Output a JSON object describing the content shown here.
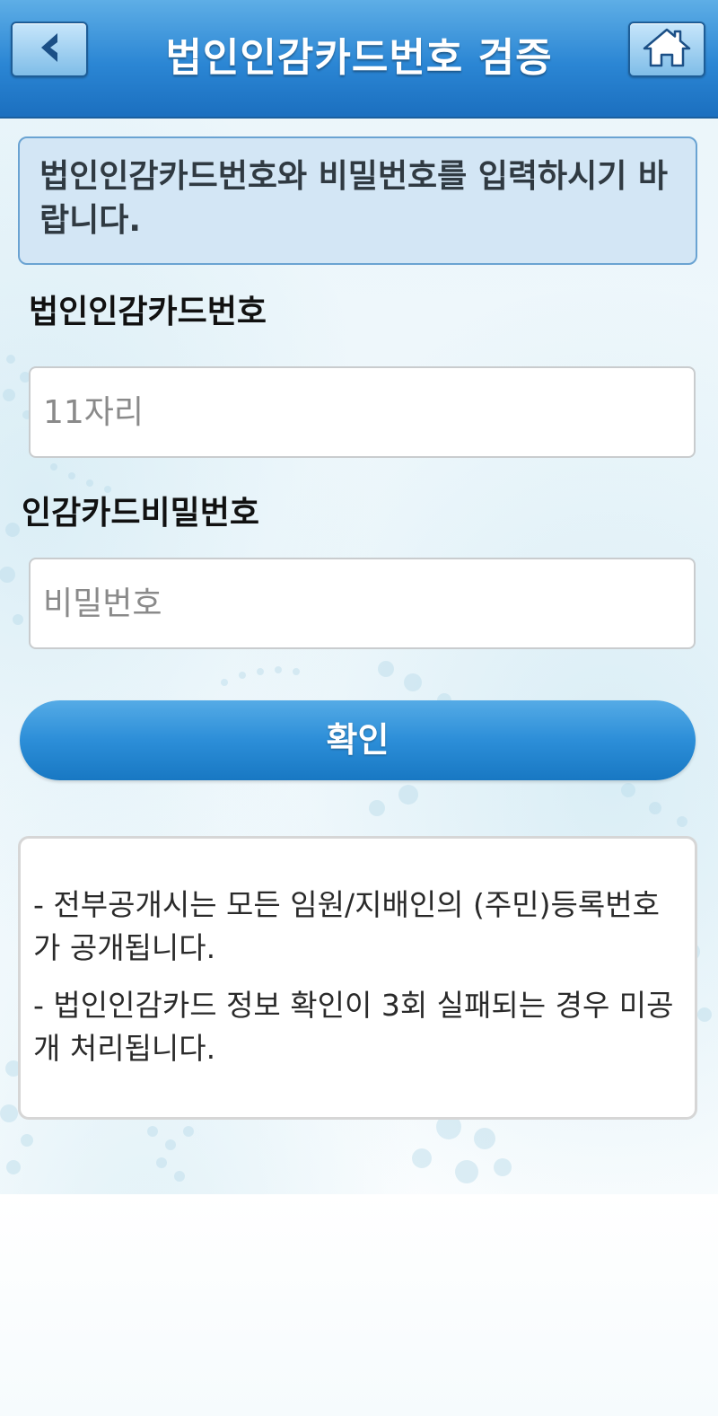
{
  "header": {
    "title": "법인인감카드번호 검증",
    "back_icon": "chevron-left-icon",
    "home_icon": "home-icon"
  },
  "notice": {
    "text": "법인인감카드번호와 비밀번호를 입력하시기 바랍니다."
  },
  "form": {
    "card_label": "법인인감카드번호",
    "card_placeholder": "11자리",
    "card_value": "",
    "password_label": "인감카드비밀번호",
    "password_placeholder": "비밀번호",
    "password_value": "",
    "confirm_label": "확인"
  },
  "info": {
    "lines": [
      "- 전부공개시는 모든 임원/지배인의 (주민)등록번호가 공개됩니다.",
      "- 법인인감카드 정보 확인이 3회 실패되는 경우 미공개 처리됩니다."
    ]
  },
  "colors": {
    "header_blue": "#2b86d4",
    "notice_bg": "#d3e6f5",
    "button_blue": "#2c8ed8"
  }
}
